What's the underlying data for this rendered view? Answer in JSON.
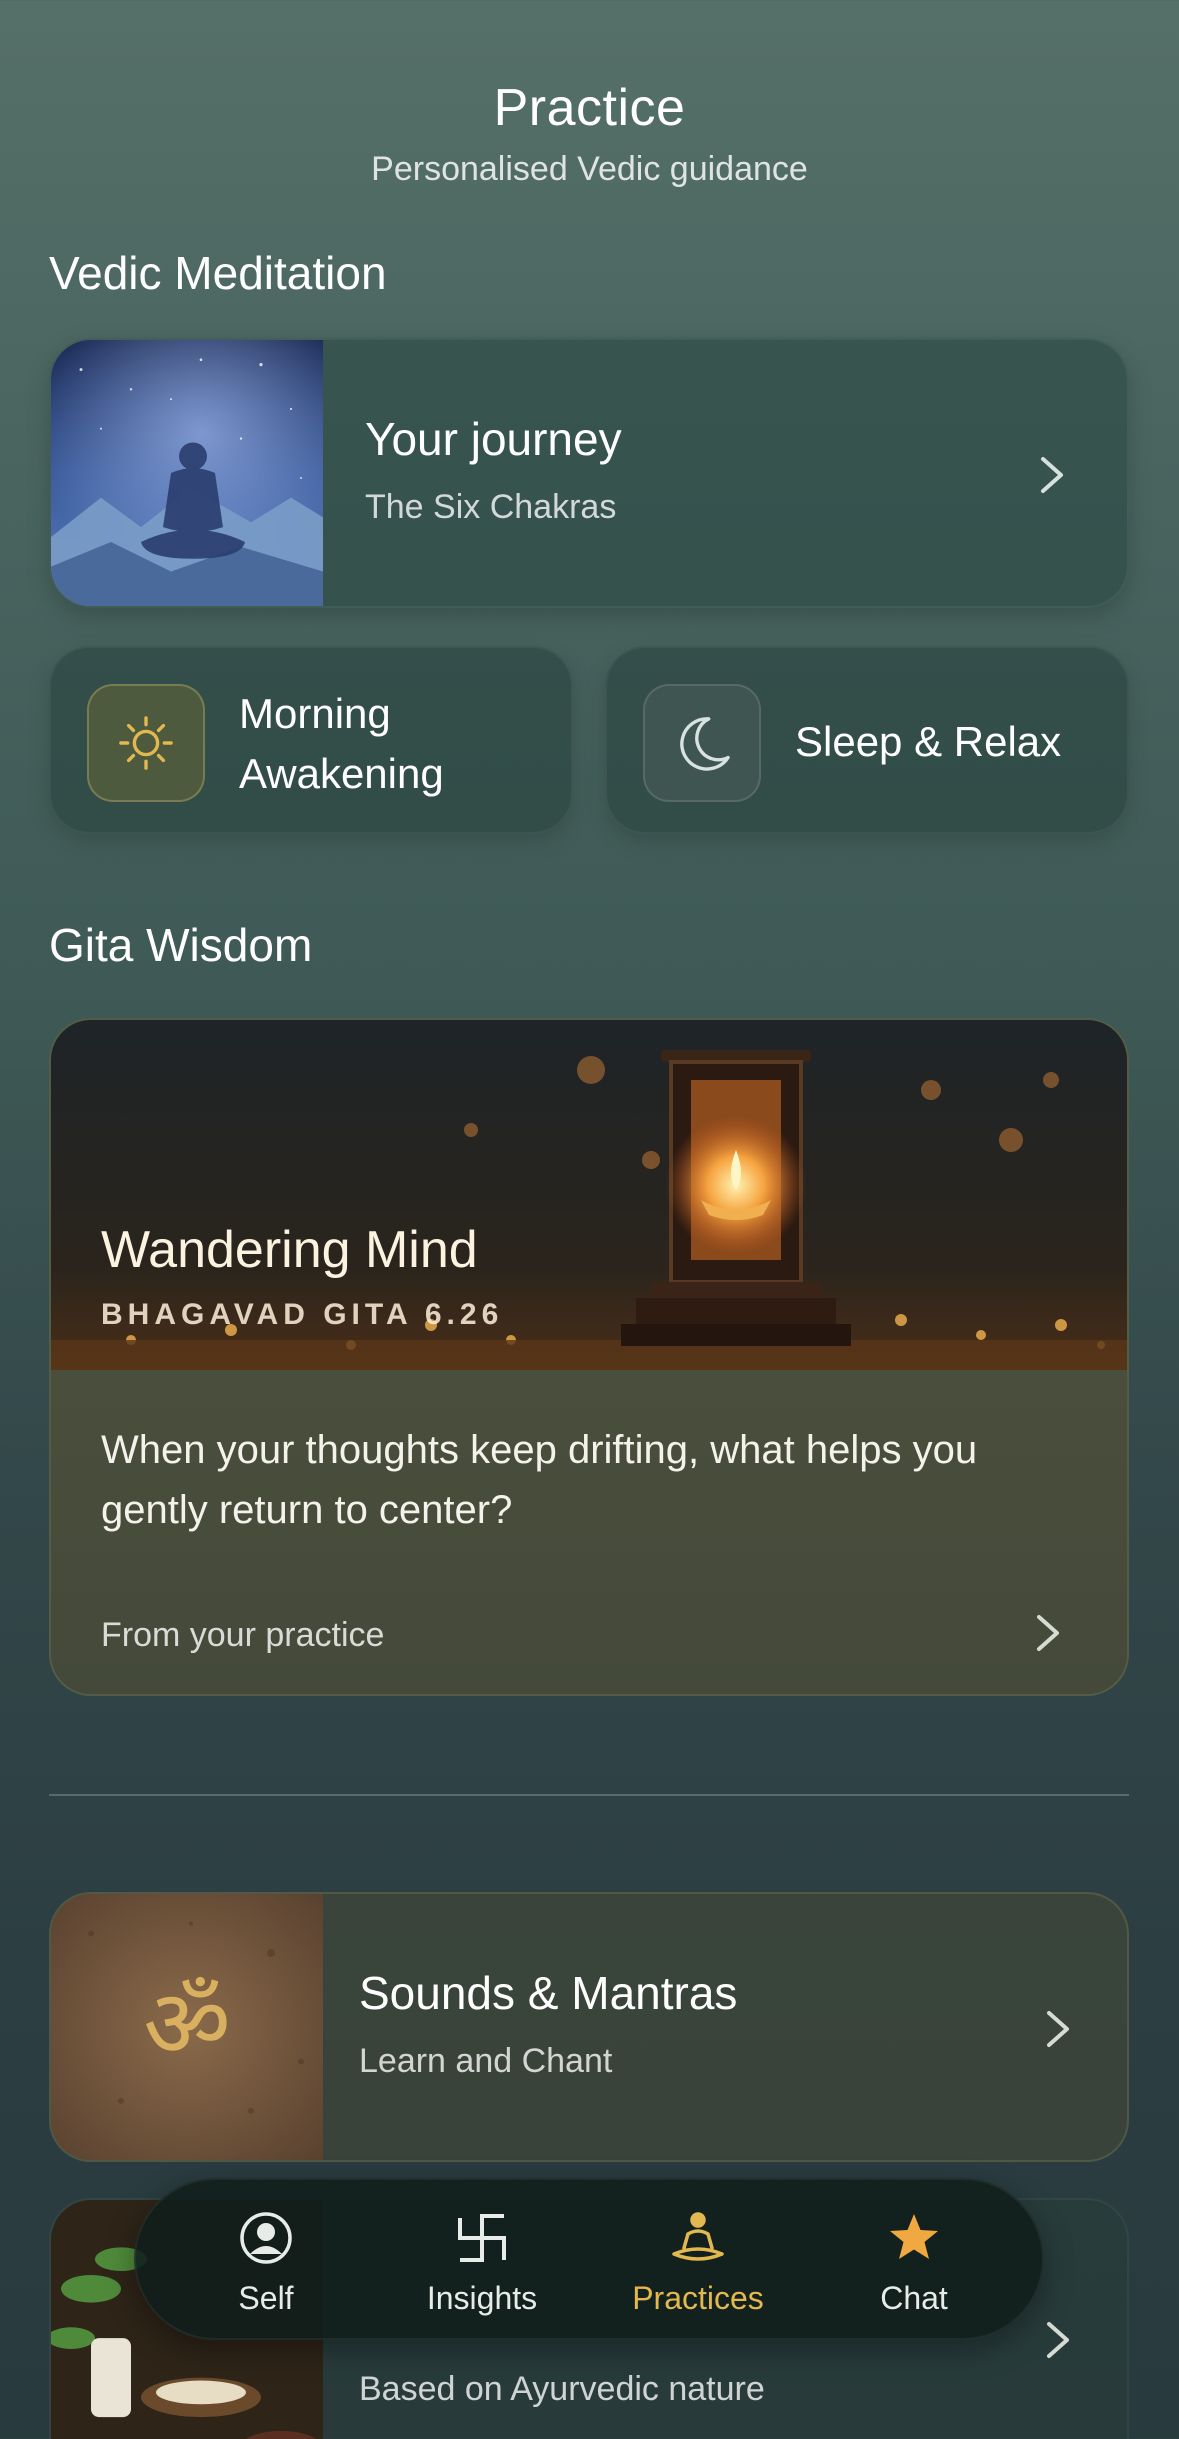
{
  "header": {
    "title": "Practice",
    "subtitle": "Personalised Vedic guidance"
  },
  "sections": {
    "meditation": "Vedic Meditation",
    "gita": "Gita Wisdom"
  },
  "journey": {
    "title": "Your journey",
    "subtitle": "The Six Chakras"
  },
  "quick": [
    {
      "label_line1": "Morning",
      "label_line2": "Awakening",
      "icon": "sun-icon"
    },
    {
      "label": "Sleep & Relax",
      "icon": "moon-icon"
    }
  ],
  "gita_card": {
    "title": "Wandering Mind",
    "reference": "BHAGAVAD GITA 6.26",
    "question": "When your thoughts keep drifting, what helps you gently return to center?",
    "footer": "From your practice"
  },
  "sounds": {
    "title": "Sounds & Mantras",
    "subtitle": "Learn and Chant",
    "symbol": "ॐ"
  },
  "diet": {
    "subtitle": "Based on Ayurvedic nature"
  },
  "tabbar": {
    "tabs": [
      {
        "label": "Self",
        "icon": "person-icon"
      },
      {
        "label": "Insights",
        "icon": "swastika-icon"
      },
      {
        "label": "Practices",
        "icon": "meditation-icon"
      },
      {
        "label": "Chat",
        "icon": "star-icon"
      }
    ],
    "active": "Practices"
  },
  "colors": {
    "accent": "#e3b84e",
    "chat_star": "#f0a840"
  }
}
